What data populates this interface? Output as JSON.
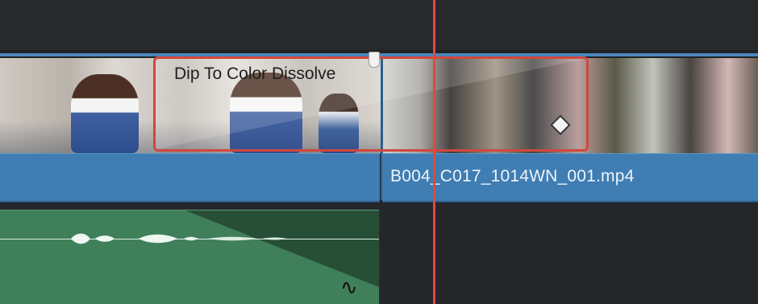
{
  "timeline": {
    "transition": {
      "label": "Dip To Color Dissolve"
    },
    "video_clip": {
      "name": "B004_C017_1014WN_001.mp4"
    },
    "audio_clip": {
      "fade_icon": "audio-fade-curve-icon"
    },
    "colors": {
      "playhead": "#e0493d",
      "video_clip_bar": "#3f7db3",
      "audio_clip": "#3f7f5a",
      "transition_outline": "#d2473d"
    }
  }
}
